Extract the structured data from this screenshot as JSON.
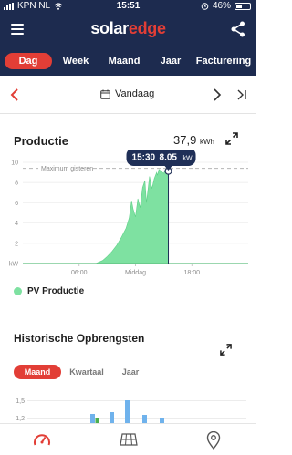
{
  "status_bar": {
    "carrier": "KPN NL",
    "time": "15:51",
    "battery": "46%",
    "battery_level": 0.46
  },
  "header": {
    "logo_part1": "solar",
    "logo_part2": "edge"
  },
  "tabs": [
    {
      "label": "Dag",
      "active": true
    },
    {
      "label": "Week",
      "active": false
    },
    {
      "label": "Maand",
      "active": false
    },
    {
      "label": "Jaar",
      "active": false
    },
    {
      "label": "Facturering",
      "active": false
    }
  ],
  "date_nav": {
    "label": "Vandaag"
  },
  "production": {
    "title": "Productie",
    "total_value": "37,9",
    "total_unit": "kWh",
    "legend": "PV Productie"
  },
  "chart_data": {
    "type": "area",
    "y_unit_label": "kW",
    "y_ticks": [
      "10",
      "8",
      "6",
      "4",
      "2"
    ],
    "x_ticks": [
      "06:00",
      "Middag",
      "18:00"
    ],
    "ylim": [
      0,
      10
    ],
    "reference_line": {
      "label": "Maximum gisteren",
      "value": 9.4
    },
    "tooltip": {
      "time": "15:30",
      "value": "8.05",
      "unit": "kW"
    },
    "series": [
      {
        "name": "PV Productie",
        "color": "#7ee1a1",
        "points": [
          [
            "07:45",
            0
          ],
          [
            "08:30",
            0.3
          ],
          [
            "09:00",
            0.7
          ],
          [
            "09:30",
            1.2
          ],
          [
            "10:00",
            1.8
          ],
          [
            "10:30",
            2.6
          ],
          [
            "11:00",
            3.5
          ],
          [
            "11:20",
            4.5
          ],
          [
            "11:35",
            6.2
          ],
          [
            "11:45",
            5.4
          ],
          [
            "12:00",
            4.6
          ],
          [
            "12:15",
            6.4
          ],
          [
            "12:30",
            5.5
          ],
          [
            "12:45",
            7.5
          ],
          [
            "13:00",
            8.2
          ],
          [
            "13:10",
            6.0
          ],
          [
            "13:30",
            8.6
          ],
          [
            "13:45",
            7.4
          ],
          [
            "14:00",
            8.4
          ],
          [
            "14:15",
            9.0
          ],
          [
            "14:20",
            8.7
          ],
          [
            "14:30",
            9.3
          ],
          [
            "15:00",
            8.9
          ],
          [
            "15:15",
            9.4
          ],
          [
            "15:25",
            9.1
          ],
          [
            "15:30",
            8.05
          ],
          [
            "15:31",
            0
          ]
        ]
      }
    ]
  },
  "history": {
    "title": "Historische Opbrengsten",
    "tabs": [
      {
        "label": "Maand",
        "active": true
      },
      {
        "label": "Kwartaal",
        "active": false
      },
      {
        "label": "Jaar",
        "active": false
      }
    ],
    "y_ticks": [
      "1,5",
      "1,2"
    ]
  },
  "colors": {
    "navy": "#1d2b4f",
    "accent_red": "#e23e36",
    "pv_green": "#7ee1a1",
    "tooltip_navy": "#1f2f57",
    "bar_blue": "#6fb2ec",
    "bar_green": "#4caf50"
  },
  "bottom_nav": {
    "icons": [
      "dashboard-gauge-icon",
      "solar-panel-icon",
      "location-pin-icon"
    ]
  }
}
